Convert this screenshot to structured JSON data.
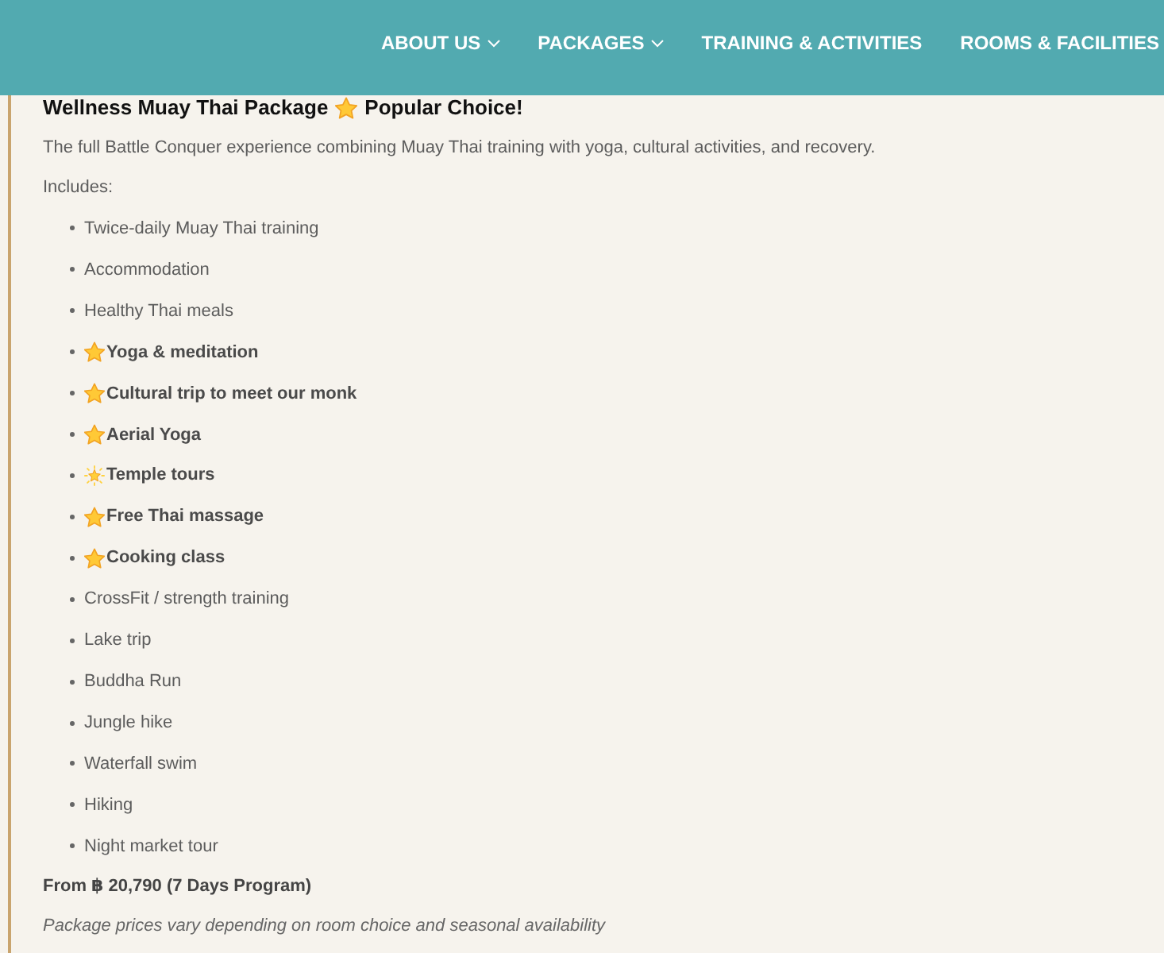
{
  "nav": [
    {
      "label": "ABOUT US",
      "dropdown": true
    },
    {
      "label": "PACKAGES",
      "dropdown": true
    },
    {
      "label": "TRAINING & ACTIVITIES",
      "dropdown": false
    },
    {
      "label": "ROOMS & FACILITIES",
      "dropdown": false
    }
  ],
  "package": {
    "title": "Wellness Muay Thai Package",
    "badge": "Popular Choice!",
    "description": "The full Battle Conquer experience combining Muay Thai training with yoga, cultural activities, and recovery.",
    "includes_label": "Includes:",
    "items": [
      {
        "text": "Twice-daily Muay Thai training",
        "kind": "plain"
      },
      {
        "text": "Accommodation",
        "kind": "plain"
      },
      {
        "text": "Healthy Thai meals",
        "kind": "plain"
      },
      {
        "text": "Yoga & meditation",
        "kind": "starred"
      },
      {
        "text": "Cultural trip to meet our monk",
        "kind": "starred"
      },
      {
        "text": "Aerial Yoga",
        "kind": "starred"
      },
      {
        "text": "Temple tours",
        "kind": "glowing"
      },
      {
        "text": "Free Thai massage",
        "kind": "starred"
      },
      {
        "text": "Cooking class",
        "kind": "starred"
      },
      {
        "text": "CrossFit / strength training",
        "kind": "plain"
      },
      {
        "text": "Lake trip",
        "kind": "plain"
      },
      {
        "text": "Buddha Run",
        "kind": "plain"
      },
      {
        "text": "Jungle hike",
        "kind": "plain"
      },
      {
        "text": "Waterfall swim",
        "kind": "plain"
      },
      {
        "text": "Hiking",
        "kind": "plain"
      },
      {
        "text": "Night market tour",
        "kind": "plain"
      }
    ],
    "price": "From ฿ 20,790 (7 Days Program)",
    "note": "Package prices vary depending on room choice and seasonal availability"
  }
}
